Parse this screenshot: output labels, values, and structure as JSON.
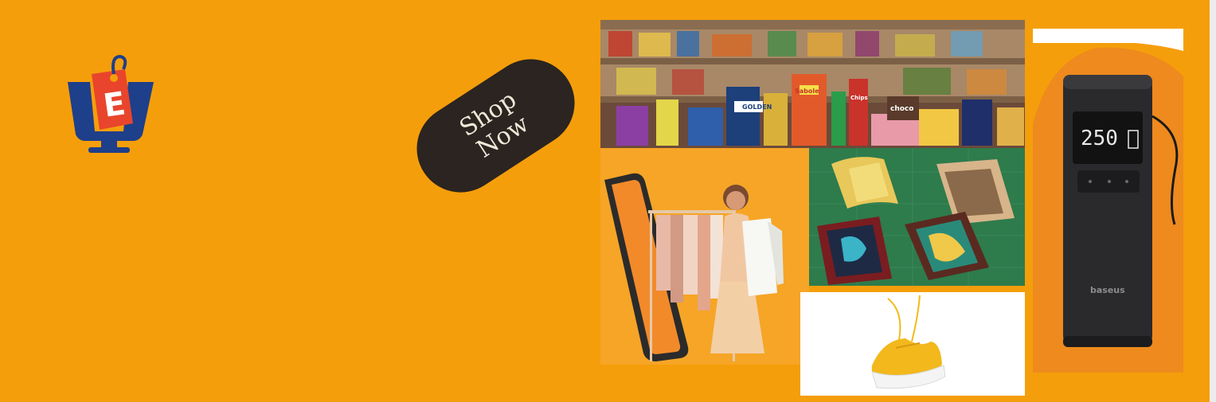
{
  "banner": {
    "cta": {
      "line1": "Shop",
      "line2": "Now"
    },
    "logo": {
      "letter": "E",
      "icon": "shopping-tag-monitor-icon"
    },
    "products": {
      "pump_display": "250",
      "pump_brand": "baseus",
      "grocery_labels": [
        "GOLDEN",
        "Sabole",
        "choco",
        "Chips"
      ]
    }
  },
  "colors": {
    "background": "#f59e0b",
    "cta": "#2b2420",
    "logo_red": "#e8452c",
    "logo_blue": "#1e3f8a"
  }
}
